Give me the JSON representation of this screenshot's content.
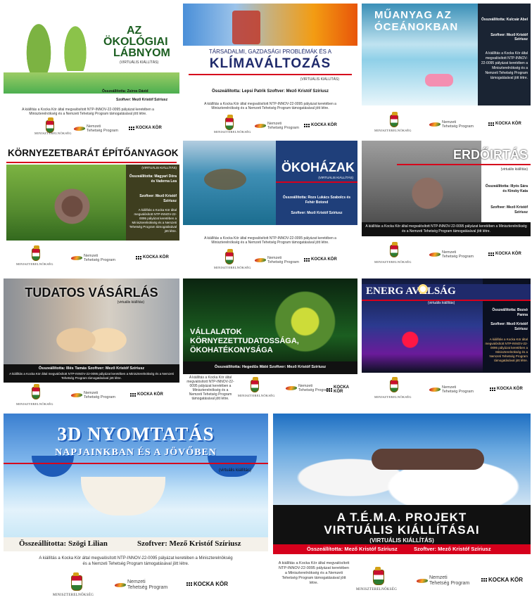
{
  "tiles": {
    "t1": {
      "title_line1": "AZ",
      "title_line2": "ÖKOLÓGIAI",
      "title_line3": "LÁBNYOM",
      "subtitle": "(VIRTUÁLIS KIÁLLÍTÁS)",
      "credit1": "Összeállította: Zsiros Dávid",
      "credit2": "Szoftver: Mező Kristóf Szíriusz",
      "note": "A kiállítás a Kocka Kör által megvalósított NTP-INNOV-22-0095 pályázat keretében a Miniszterelnökség és a Nemzeti Tehetség Program támogatásával jött létre."
    },
    "t2": {
      "pre": "TÁRSADALMI, GAZDASÁGI PROBLÉMÁK ÉS A",
      "title": "KLÍMAVÁLTOZÁS",
      "subtitle": "(VIRTUÁLIS KIÁLLÍTÁS)",
      "credit": "Összeállította: Lepsi Patrik   Szoftver: Mező Kristóf Szíriusz",
      "note": "A kiállítás a Kocka Kör által megvalósított NTP-INNOV-22-0095 pályázat keretében a Miniszterelnökség és a Nemzeti Tehetség Program támogatásával jött létre."
    },
    "t3": {
      "title_line1": "MŰANYAG AZ",
      "title_line2": "ÓCEÁNOKBAN",
      "credit1": "Összeállította: Kulcsár Abel",
      "credit2": "Szoftver: Mező Kristóf Szíriusz",
      "note": "A kiállítás a Kocka Kör által megvalósított NTP-INNOV-22-0095 pályázat keretében a Miniszterelnökség és a Nemzeti Tehetség Program támogatásával jött létre."
    },
    "t4": {
      "title": "KÖRNYEZETBARÁT ÉPÍTŐANYAGOK",
      "subtitle": "(VIRTUÁLIS KIÁLLÍTÁS)",
      "credit1": "Összeállította: Magyari Dóra és Vaderna Lea",
      "credit2": "Szoftver: Mező Kristóf Szíriusz",
      "note": "A kiállítás a Kocka Kör által megvalósított NTP-INNOV-22-0095 pályázat keretében a Miniszterelnökség és a Nemzeti Tehetség Program támogatásával jött létre."
    },
    "t5": {
      "title": "ÖKOHÁZAK",
      "subtitle": "(VIRTUÁLIS KIÁLLÍTÁS)",
      "credit1": "Összeállította: Rozs Lukács Szabolcs és Fehér Botond",
      "credit2": "Szoftver: Mező Kristóf Szíriusz",
      "note": "A kiállítás a Kocka Kör által megvalósított NTP-INNOV-22-0095 pályázat keretében a Miniszterelnökség és a Nemzeti Tehetség Program támogatásával jött létre."
    },
    "t6": {
      "title": "ERDŐIRTÁS",
      "subtitle": "(virtuális kiállítás)",
      "credit1": "Összeállította: Illyés Sára és Kinsky Kata",
      "credit2": "Szoftver: Mező Kristóf Szíriusz",
      "note": "A kiállítás a Kocka Kör által megvalósított NTP-INNOV-22-0095 pályázat keretében a Miniszterelnökség és a Nemzeti Tehetség Program támogatásával jött létre."
    },
    "t7": {
      "title": "TUDATOS VÁSÁRLÁS",
      "subtitle": "(virtuális kiállítás)",
      "credit": "Összeállította: Illés Tamás      Szoftver: Mező Kristóf Szíriusz",
      "note": "A kiállítás a Kocka Kör által megvalósított NTP-INNOV-22-0095 pályázat keretében a Miniszterelnökség és a Nemzeti Tehetség Program támogatásával jött létre."
    },
    "t8": {
      "title_line1": "VÁLLALATOK",
      "title_line2": "KÖRNYEZETTUDATOSSÁGA,",
      "title_line3": "ÖKOHATÉKONYSÁGA",
      "credit": "Összeállította: Hegedűs Máté   Szoftver: Mező Kristóf Szíriusz",
      "note": "A kiállítás a Kocka Kör által megvalósított NTP-INNOV-22-0095 pályázat keretében a Miniszterelnökség és a Nemzeti Tehetség Program támogatásával jött létre."
    },
    "t9": {
      "title": "ENERG AVÁLSÁG",
      "subtitle": "(virtuális kiállítás)",
      "credit1": "Összeállította: Bozsó Panna",
      "credit2": "Szoftver: Mező Kristóf Szíriusz",
      "note": "A kiállítás a Kocka Kör által megvalósított NTP-INNOV-22-0095 pályázat keretében a Miniszterelnökség és a Nemzeti Tehetség Program támogatásával jött létre."
    },
    "t10": {
      "title_line1": "3D NYOMTATÁS",
      "title_line2": "NAPJAINKBAN ÉS A JÖVŐBEN",
      "subtitle": "(virtuális kiállítás)",
      "credit1": "Összeállította: Szögi Lilian",
      "credit2": "Szoftver: Mező Kristóf Szíriusz",
      "note": "A kiállítás a Kocka Kör által megvalósított NTP-INNOV-22-0095 pályázat keretében a Miniszterelnökség és a Nemzeti Tehetség Program támogatásával jött létre."
    },
    "t11": {
      "title_line1": "A T.É.M.A. PROJEKT",
      "title_line2": "VIRTUÁLIS KIÁLLÍTÁSAI",
      "subtitle": "(VIRTUÁLIS KIÁLLÍTÁS)",
      "credit1": "Összeállította: Mező Kristóf Szíriusz",
      "credit2": "Szoftver: Mező Kristóf Szíriusz",
      "note": "A kiállítás a Kocka Kör által megvalósított NTP-INNOV-22-0095 pályázat keretében a Miniszterelnökség és a Nemzeti Tehetség Program támogatásával jött létre."
    }
  },
  "logos": {
    "ministry": "MINISZTERELNÖKSÉG",
    "ntp_line1": "Nemzeti",
    "ntp_line2": "Tehetség Program",
    "kocka": "KOCKA KÖR"
  },
  "colors": {
    "accent_red": "#d6001c",
    "dark_blue": "#1f2a6b",
    "green": "#2e7d32"
  }
}
